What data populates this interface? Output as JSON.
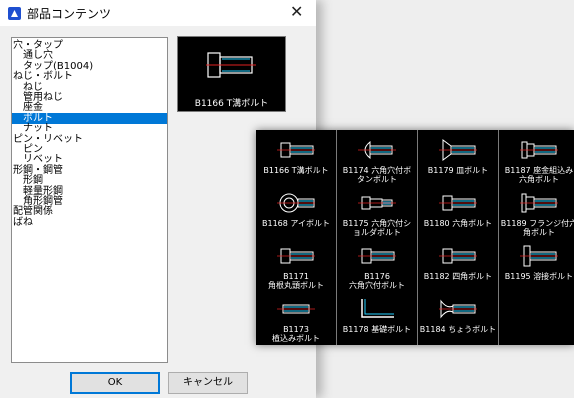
{
  "window": {
    "title": "部品コンテンツ",
    "close_label": "✕"
  },
  "tree": [
    {
      "label": "穴・タップ"
    },
    {
      "label": "通し穴"
    },
    {
      "label": "タップ(B1004)"
    },
    {
      "label": "ねじ・ボルト"
    },
    {
      "label": "ねじ"
    },
    {
      "label": "管用ねじ"
    },
    {
      "label": "座金"
    },
    {
      "label": "ボルト",
      "selected": true
    },
    {
      "label": "ナット"
    },
    {
      "label": "ピン・リベット"
    },
    {
      "label": "ピン"
    },
    {
      "label": "リベット"
    },
    {
      "label": "形鋼・鋼管"
    },
    {
      "label": "形鋼"
    },
    {
      "label": "軽量形鋼"
    },
    {
      "label": "角形鋼管"
    },
    {
      "label": "配管関係"
    },
    {
      "label": "ばね"
    }
  ],
  "preview": {
    "label": "B1166 T溝ボルト"
  },
  "buttons": {
    "ok": "OK",
    "cancel": "キャンセル"
  },
  "gallery": [
    {
      "line1": "B1166 T溝ボルト",
      "line2": "",
      "icon": "bolt-icon"
    },
    {
      "line1": "B1168 アイボルト",
      "line2": "",
      "icon": "eye-bolt-icon"
    },
    {
      "line1": "B1171",
      "line2": "角根丸頭ボルト",
      "icon": "bolt-icon"
    },
    {
      "line1": "B1173",
      "line2": "植込みボルト",
      "icon": "stud-icon"
    },
    {
      "line1": "B1174 六角穴付ボ",
      "line2": "タンボルト",
      "icon": "button-bolt-icon"
    },
    {
      "line1": "B1175 六角穴付シ",
      "line2": "ョルダボルト",
      "icon": "shoulder-bolt-icon"
    },
    {
      "line1": "B1176",
      "line2": "六角穴付ボルト",
      "icon": "socket-bolt-icon"
    },
    {
      "line1": "B1178 基礎ボルト",
      "line2": "",
      "icon": "anchor-bolt-icon"
    },
    {
      "line1": "B1179 皿ボルト",
      "line2": "",
      "icon": "flat-bolt-icon"
    },
    {
      "line1": "B1180 六角ボルト",
      "line2": "",
      "icon": "hex-bolt-icon"
    },
    {
      "line1": "B1182 四角ボルト",
      "line2": "",
      "icon": "square-bolt-icon"
    },
    {
      "line1": "B1184 ちょうボルト",
      "line2": "",
      "icon": "wing-bolt-icon"
    },
    {
      "line1": "B1187 座金組込み",
      "line2": "六角ボルト",
      "icon": "washer-bolt-icon"
    },
    {
      "line1": "B1189 フランジ付六",
      "line2": "角ボルト",
      "icon": "flange-bolt-icon"
    },
    {
      "line1": "B1195 溶接ボルト",
      "line2": "",
      "icon": "weld-bolt-icon"
    }
  ]
}
